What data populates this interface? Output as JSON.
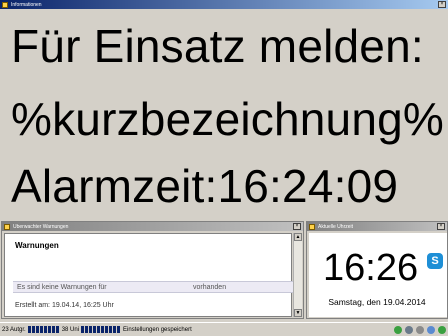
{
  "info_window": {
    "title": "Informationen",
    "line1": "Für Einsatz melden:",
    "line2": "%kurzbezeichnung%",
    "line3": "Alarmzeit:16:24:09"
  },
  "warnings_window": {
    "title": "Überwachter Warnungen",
    "heading": "Warnungen",
    "message": "Es sind keine Warnungen für",
    "message_tail": "vorhanden",
    "footer": "Erstellt am: 19.04.14, 16:25 Uhr",
    "scroll_up": "▲",
    "scroll_down": "▼"
  },
  "clock_window": {
    "title": "Aktuelle Uhrzeit",
    "time": "16:26",
    "date": "Samstag, den 19.04.2014",
    "skype_glyph": "S"
  },
  "statusbar": {
    "seg1_label": "23 Autgr.",
    "seg2_label": "38 Uni",
    "seg3_label": "Einstellungen gespeichert",
    "close_glyph": "×"
  },
  "colors": {
    "title_active": "#0a246a",
    "title_inactive": "#808080",
    "progress": "#0a246a"
  }
}
